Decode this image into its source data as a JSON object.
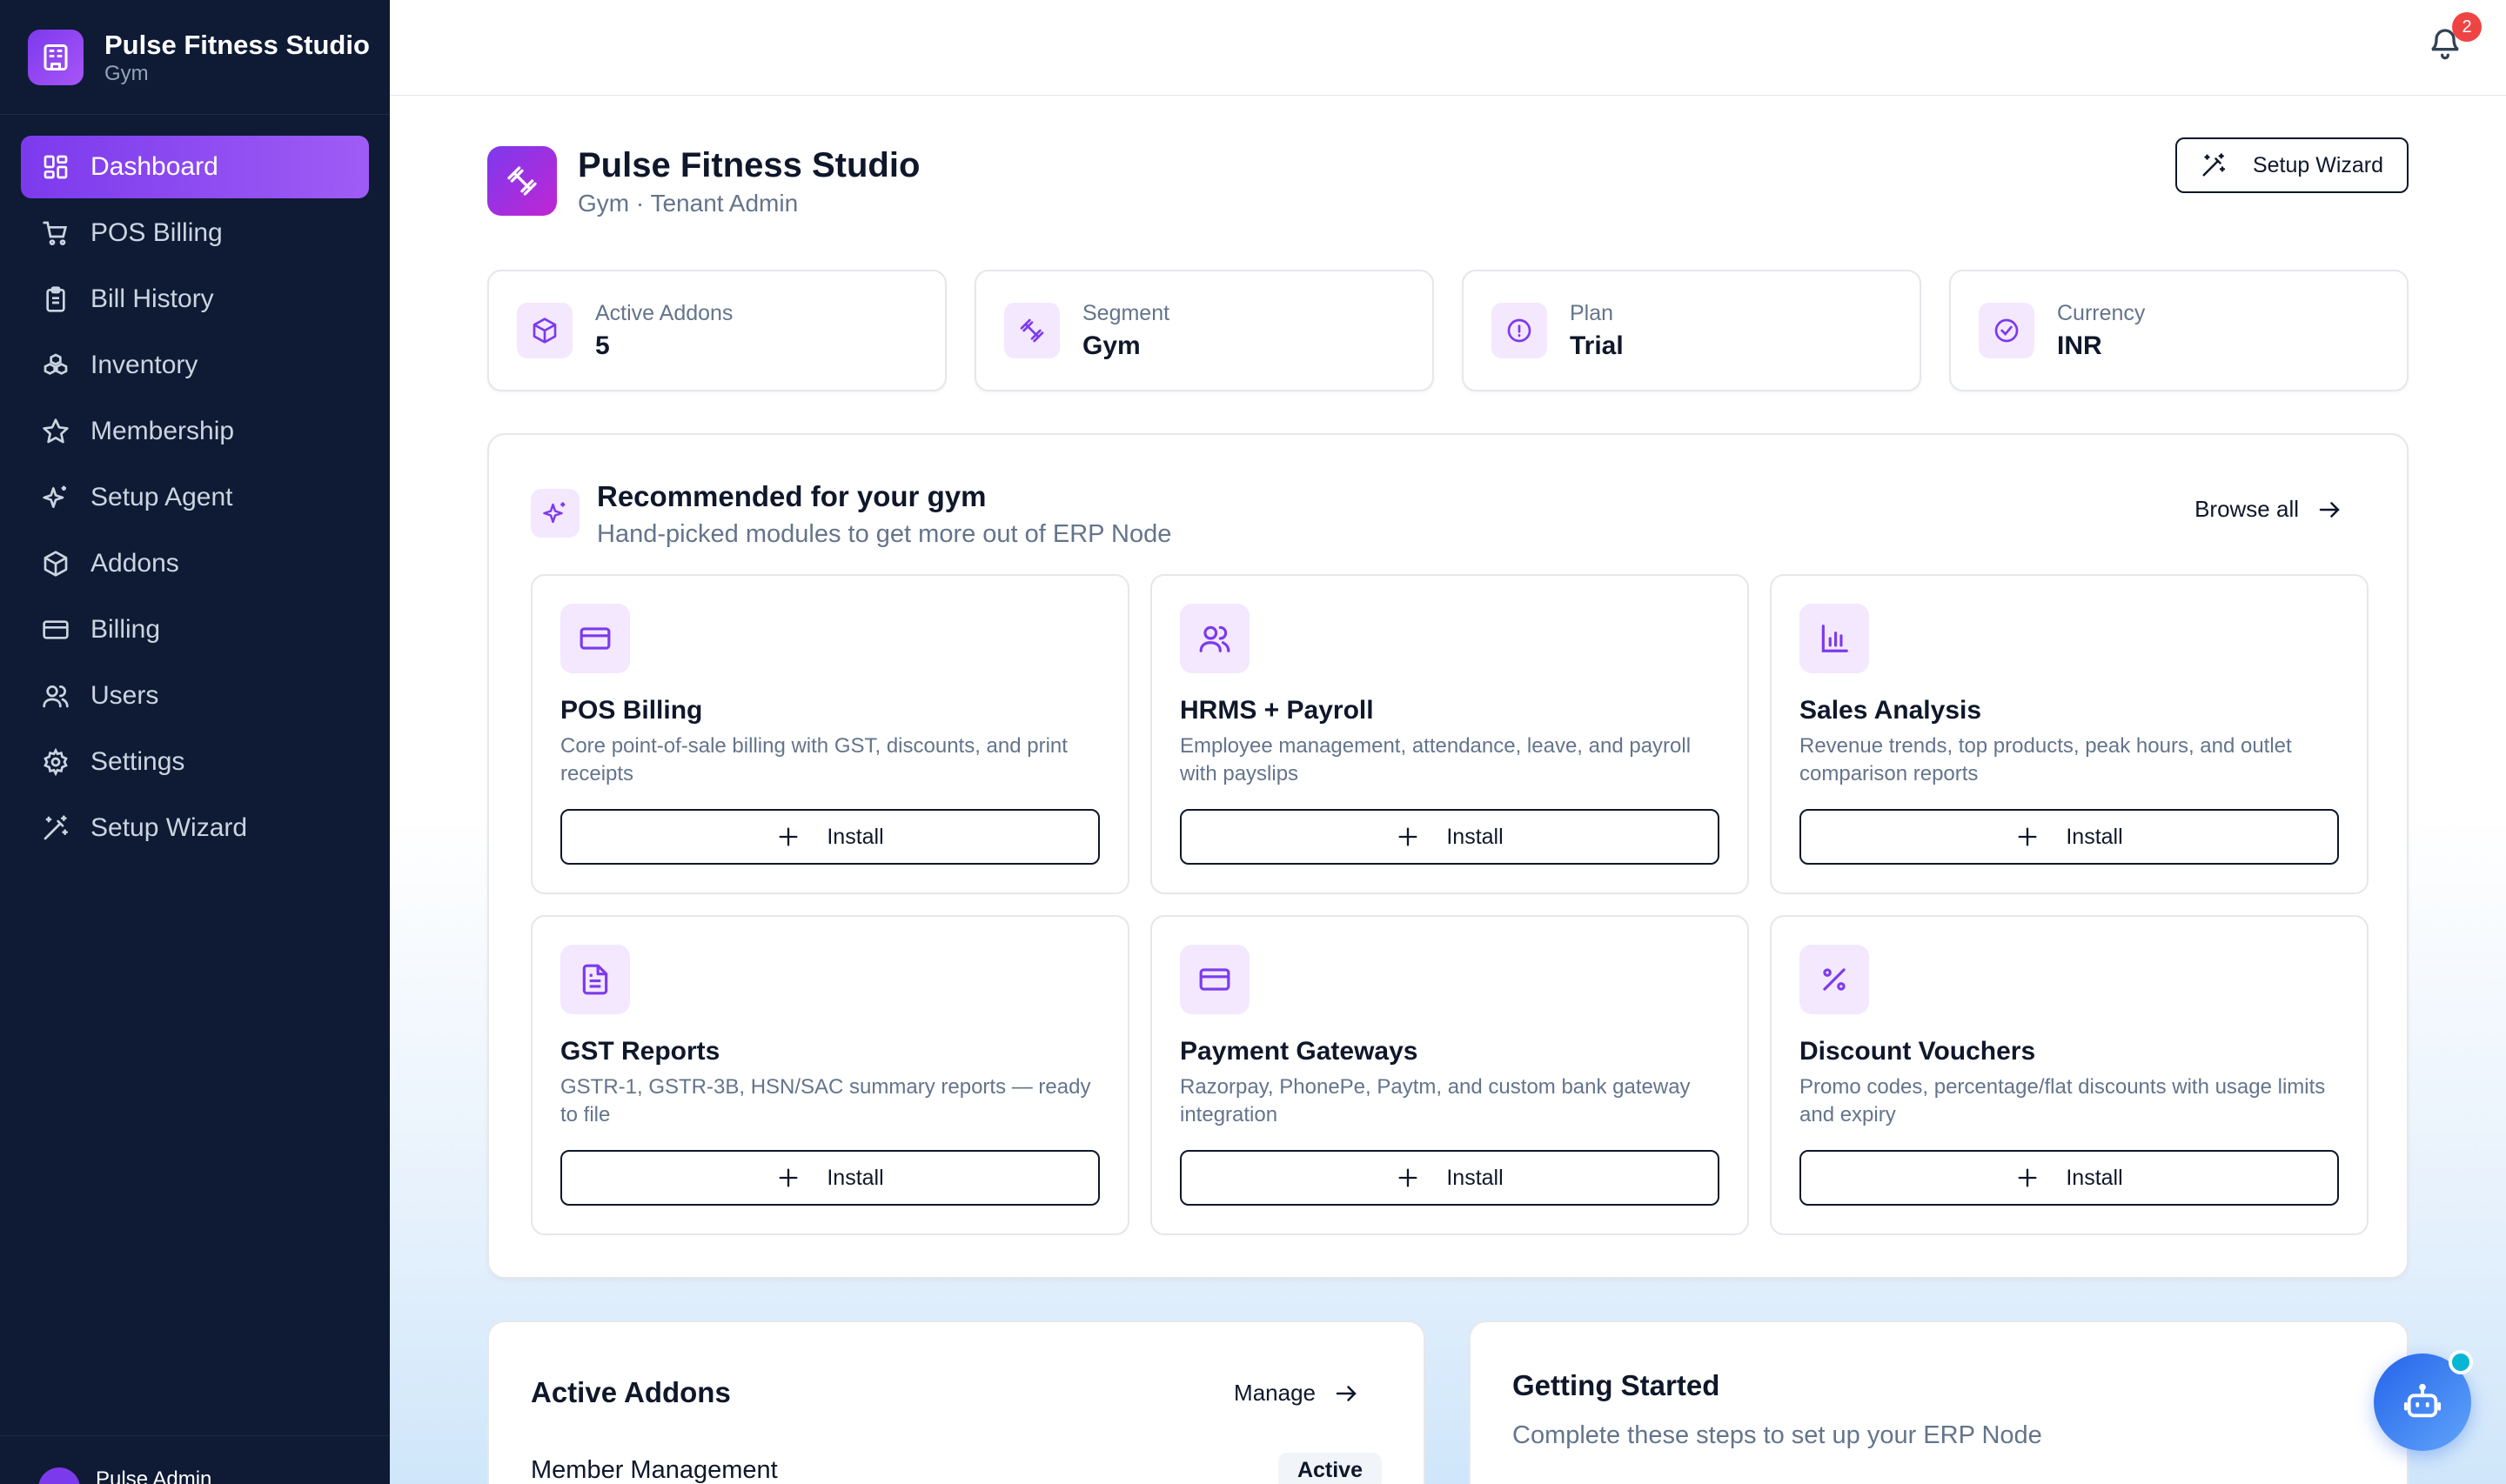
{
  "brand": {
    "name": "Pulse Fitness Studio",
    "segment": "Gym"
  },
  "sidebar": {
    "items": [
      {
        "label": "Dashboard",
        "icon": "dashboard-icon",
        "active": true
      },
      {
        "label": "POS Billing",
        "icon": "cart-icon"
      },
      {
        "label": "Bill History",
        "icon": "clipboard-icon"
      },
      {
        "label": "Inventory",
        "icon": "boxes-icon"
      },
      {
        "label": "Membership",
        "icon": "star-icon"
      },
      {
        "label": "Setup Agent",
        "icon": "sparkles-icon"
      },
      {
        "label": "Addons",
        "icon": "package-icon"
      },
      {
        "label": "Billing",
        "icon": "card-icon"
      },
      {
        "label": "Users",
        "icon": "users-icon"
      },
      {
        "label": "Settings",
        "icon": "gear-icon"
      },
      {
        "label": "Setup Wizard",
        "icon": "wand-icon"
      }
    ],
    "footer_user": "Pulse Admin"
  },
  "topbar": {
    "notification_count": "2"
  },
  "header": {
    "title": "Pulse Fitness Studio",
    "subtitle": "Gym · Tenant Admin",
    "wizard_label": "Setup Wizard"
  },
  "stats": [
    {
      "label": "Active Addons",
      "value": "5",
      "icon": "package-icon"
    },
    {
      "label": "Segment",
      "value": "Gym",
      "icon": "dumbbell-icon"
    },
    {
      "label": "Plan",
      "value": "Trial",
      "icon": "alert-circle-icon"
    },
    {
      "label": "Currency",
      "value": "INR",
      "icon": "check-circle-icon"
    }
  ],
  "recommended": {
    "title": "Recommended for your gym",
    "subtitle": "Hand-picked modules to get more out of ERP Node",
    "browse_label": "Browse all",
    "install_label": "Install",
    "modules": [
      {
        "title": "POS Billing",
        "desc": "Core point-of-sale billing with GST, discounts, and print receipts",
        "icon": "card-icon"
      },
      {
        "title": "HRMS + Payroll",
        "desc": "Employee management, attendance, leave, and payroll with payslips",
        "icon": "users-icon"
      },
      {
        "title": "Sales Analysis",
        "desc": "Revenue trends, top products, peak hours, and outlet comparison reports",
        "icon": "bar-chart-icon"
      },
      {
        "title": "GST Reports",
        "desc": "GSTR-1, GSTR-3B, HSN/SAC summary reports — ready to file",
        "icon": "file-text-icon"
      },
      {
        "title": "Payment Gateways",
        "desc": "Razorpay, PhonePe, Paytm, and custom bank gateway integration",
        "icon": "card-icon"
      },
      {
        "title": "Discount Vouchers",
        "desc": "Promo codes, percentage/flat discounts with usage limits and expiry",
        "icon": "percent-icon"
      }
    ]
  },
  "active_addons": {
    "title": "Active Addons",
    "manage_label": "Manage",
    "first_item": "Member Management",
    "first_status": "Active"
  },
  "getting_started": {
    "title": "Getting Started",
    "subtitle": "Complete these steps to set up your ERP Node"
  },
  "colors": {
    "sidebar_bg": "#0f1b35",
    "accent": "#7c3aed",
    "badge": "#ef4444"
  }
}
